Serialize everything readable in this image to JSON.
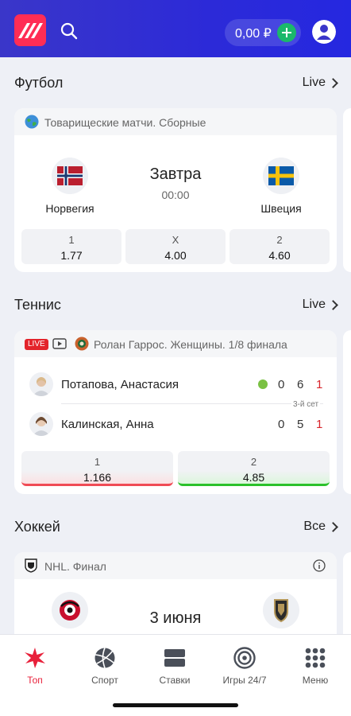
{
  "header": {
    "balance": "0,00 ₽"
  },
  "football": {
    "title": "Футбол",
    "link": "Live",
    "league": "Товарищеские матчи. Сборные",
    "home": "Норвегия",
    "away": "Швеция",
    "day": "Завтра",
    "time": "00:00",
    "odds": [
      {
        "label": "1",
        "value": "1.77"
      },
      {
        "label": "X",
        "value": "4.00"
      },
      {
        "label": "2",
        "value": "4.60"
      }
    ]
  },
  "tennis": {
    "title": "Теннис",
    "link": "Live",
    "live_badge": "LIVE",
    "league": "Ролан Гаррос. Женщины. 1/8 финала",
    "players": [
      {
        "name": "Потапова, Анастасия",
        "sets": "0",
        "games": "6",
        "points": "1"
      },
      {
        "name": "Калинская, Анна",
        "sets": "0",
        "games": "5",
        "points": "1"
      }
    ],
    "set_label": "3-й сет",
    "odds": [
      {
        "label": "1",
        "value": "1.166"
      },
      {
        "label": "2",
        "value": "4.85"
      }
    ],
    "colors": {
      "down": "#f04b55",
      "up": "#2bc12b",
      "serve": "#7ac143",
      "points": "#d8232a"
    }
  },
  "hockey": {
    "title": "Хоккей",
    "link": "Все",
    "league": "NHL. Финал",
    "day": "3 июня"
  },
  "nav": {
    "items": [
      {
        "label": "Топ",
        "icon": "star-burst-icon"
      },
      {
        "label": "Спорт",
        "icon": "volleyball-icon"
      },
      {
        "label": "Ставки",
        "icon": "ticket-icon"
      },
      {
        "label": "Игры 24/7",
        "icon": "target-icon"
      },
      {
        "label": "Меню",
        "icon": "grid-dots-icon"
      }
    ],
    "active_color": "#e8203a"
  }
}
